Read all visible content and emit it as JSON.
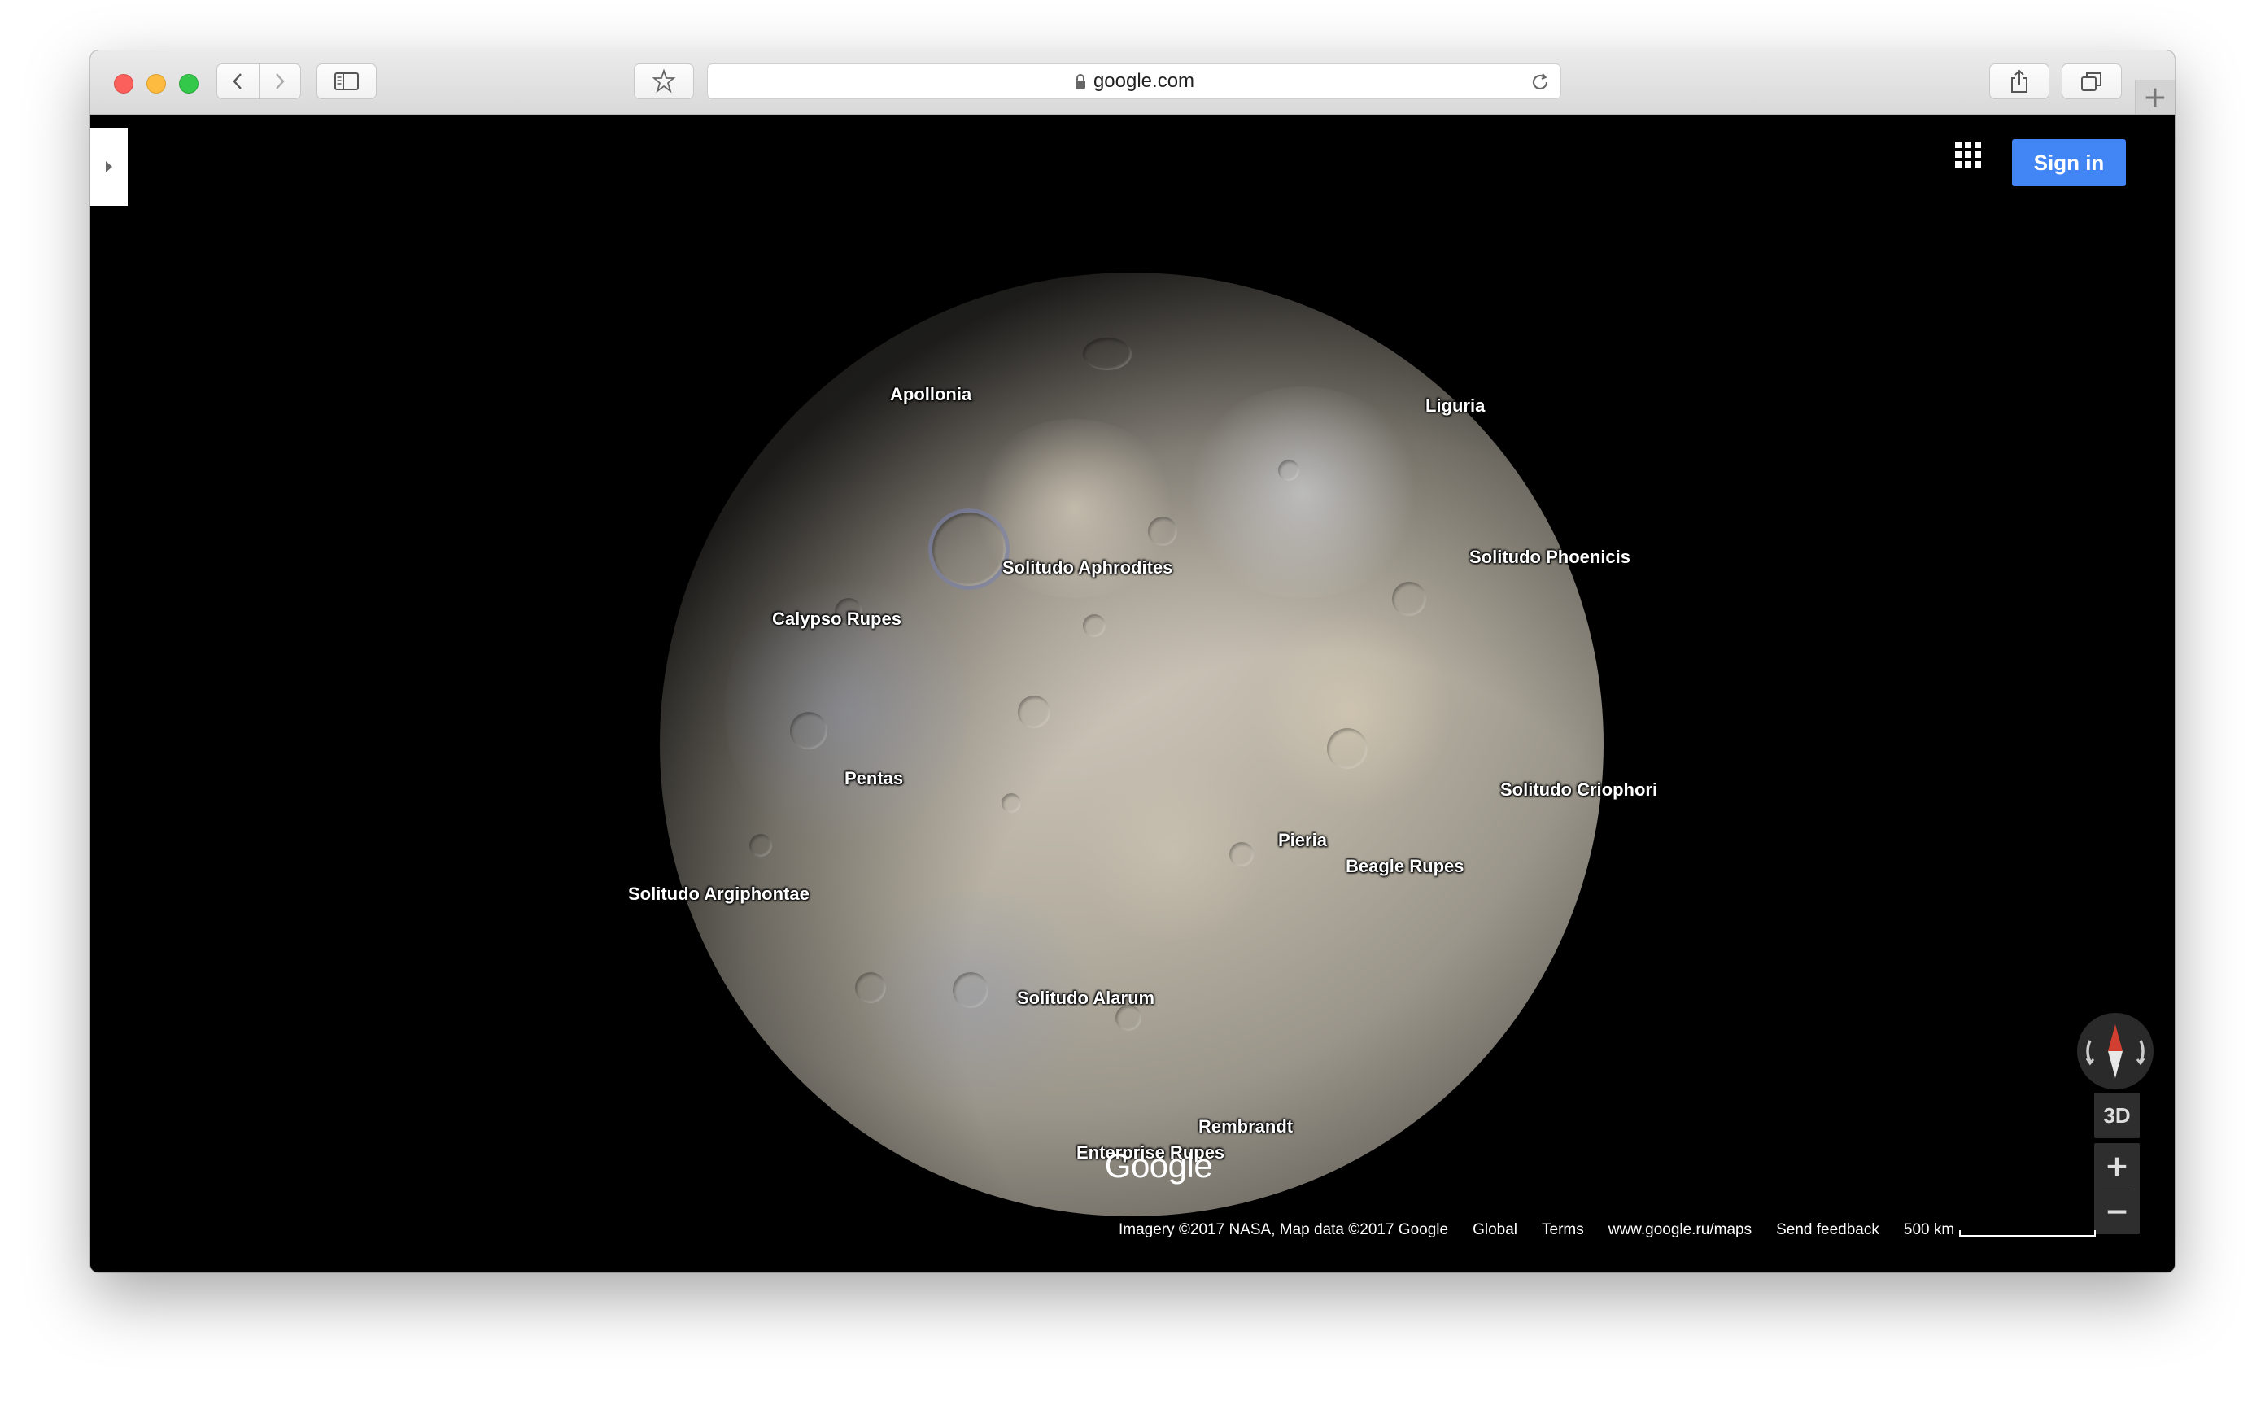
{
  "browser": {
    "url": "google.com",
    "new_tab_symbol": "+"
  },
  "map": {
    "sign_in": "Sign in",
    "labels": [
      "Apollonia",
      "Liguria",
      "Solitudo Aphrodites",
      "Solitudo Phoenicis",
      "Calypso Rupes",
      "Pentas",
      "Solitudo Criophori",
      "Pieria",
      "Beagle Rupes",
      "Solitudo Argiphontae",
      "Solitudo Alarum",
      "Rembrandt",
      "Enterprise Rupes"
    ],
    "controls": {
      "view_3d": "3D",
      "zoom_in": "+",
      "zoom_out": "−"
    },
    "logo": "Google",
    "footer": {
      "imagery": "Imagery ©2017 NASA, Map data ©2017 Google",
      "global": "Global",
      "terms": "Terms",
      "maps_link": "www.google.ru/maps",
      "feedback": "Send feedback",
      "scale": "500 km"
    }
  },
  "colors": {
    "sign_in_blue": "#4285f4",
    "map_background": "#000000",
    "compass_needle": "#d23f31"
  }
}
